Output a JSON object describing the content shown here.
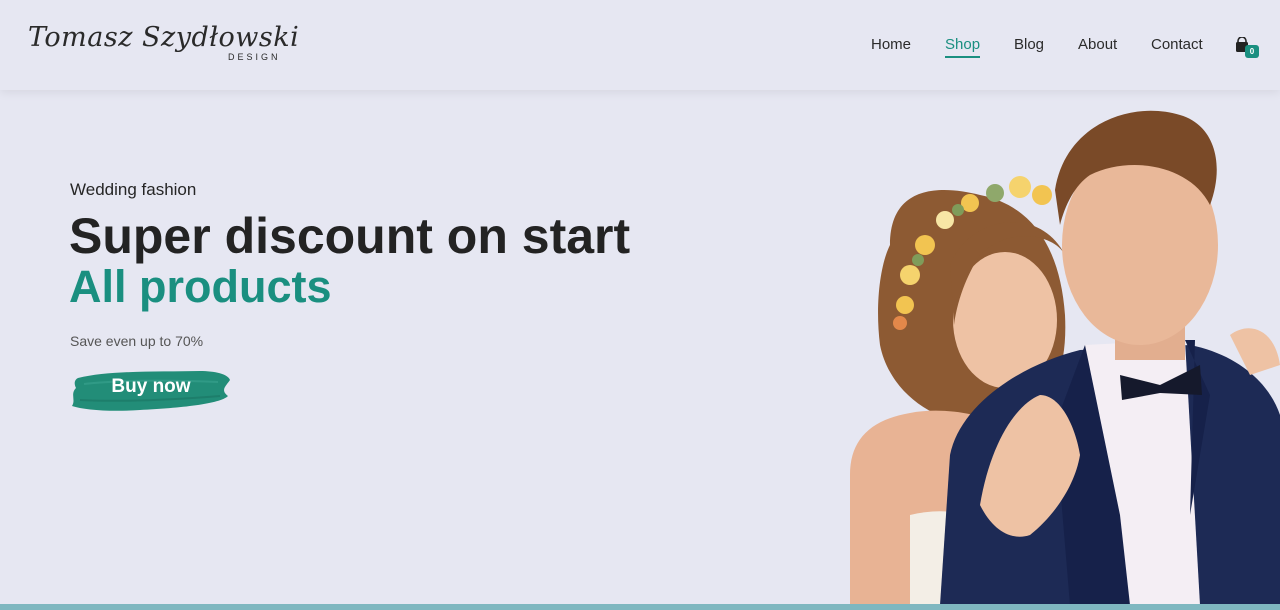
{
  "brand": {
    "name": "Tomasz Szydłowski",
    "subtitle": "DESIGN"
  },
  "nav": {
    "items": [
      {
        "label": "Home",
        "active": false
      },
      {
        "label": "Shop",
        "active": true
      },
      {
        "label": "Blog",
        "active": false
      },
      {
        "label": "About",
        "active": false
      },
      {
        "label": "Contact",
        "active": false
      }
    ],
    "cart": {
      "icon": "shopping-bag-icon",
      "count": "0"
    }
  },
  "hero": {
    "kicker": "Wedding fashion",
    "title": "Super discount on start",
    "subtitle": "All products",
    "note": "Save even up to 70%",
    "cta_label": "Buy now"
  },
  "colors": {
    "accent": "#1a8f80",
    "background": "#e6e7f2",
    "text": "#232323"
  }
}
